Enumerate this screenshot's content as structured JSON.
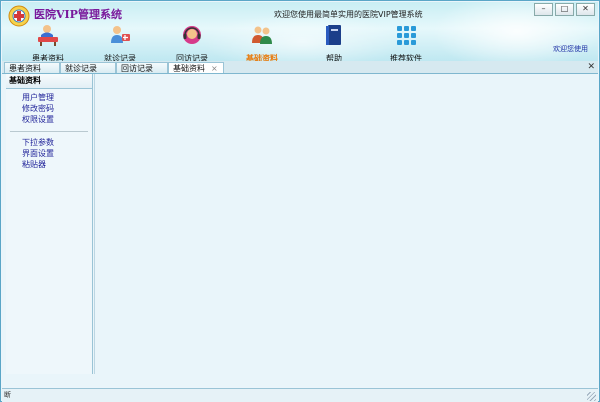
{
  "window": {
    "title": "医院VIP管理系统",
    "welcome": "欢迎您使用最简单实用的医院VIP管理系统",
    "controls": {
      "minimize": "–",
      "maximize": "□",
      "close": "✕"
    }
  },
  "toolbar": {
    "items": [
      {
        "label": "患者资料",
        "icon": "patient-desk-icon"
      },
      {
        "label": "就诊记录",
        "icon": "doctor-visit-icon"
      },
      {
        "label": "回访记录",
        "icon": "headset-icon"
      },
      {
        "label": "基础资料",
        "icon": "people-icon",
        "active": true
      },
      {
        "label": "帮助",
        "icon": "help-book-icon"
      },
      {
        "label": "推荐软件",
        "icon": "apps-grid-icon"
      }
    ],
    "user_greeting": "欢迎您使用"
  },
  "tabs": {
    "items": [
      {
        "label": "患者资料"
      },
      {
        "label": "就诊记录"
      },
      {
        "label": "回访记录"
      },
      {
        "label": "基础资料",
        "active": true
      }
    ],
    "tab_close": "×",
    "close_all": "✕"
  },
  "left_panel": {
    "header": "基础资料",
    "group1": [
      "用户管理",
      "修改密码",
      "权限设置"
    ],
    "group2": [
      "下拉参数",
      "界面设置",
      "粘贴器"
    ]
  },
  "status_bar": {
    "cell1": "断"
  },
  "colors": {
    "accent_active": "#e87a0c",
    "title": "#7a1a9c",
    "link": "#22259a"
  }
}
